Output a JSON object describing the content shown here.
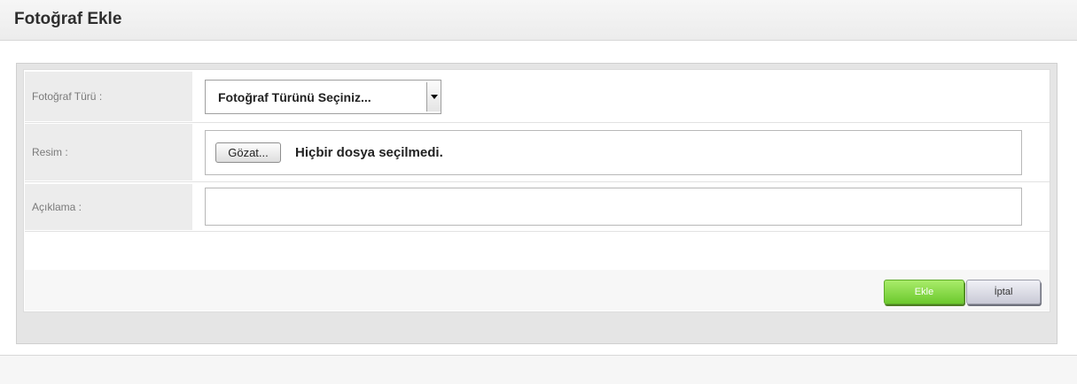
{
  "header": {
    "title": "Fotoğraf Ekle"
  },
  "form": {
    "photo_type": {
      "label": "Fotoğraf Türü :",
      "selected": "Fotoğraf Türünü Seçiniz..."
    },
    "image": {
      "label": "Resim :",
      "browse_label": "Gözat...",
      "status": "Hiçbir dosya seçilmedi."
    },
    "description": {
      "label": "Açıklama :",
      "value": ""
    }
  },
  "actions": {
    "add_label": "Ekle",
    "cancel_label": "İptal"
  },
  "icons": {
    "select_arrow": "chevron-down-icon"
  },
  "colors": {
    "add_button": "#6cc92e",
    "cancel_button": "#c9cad6"
  }
}
